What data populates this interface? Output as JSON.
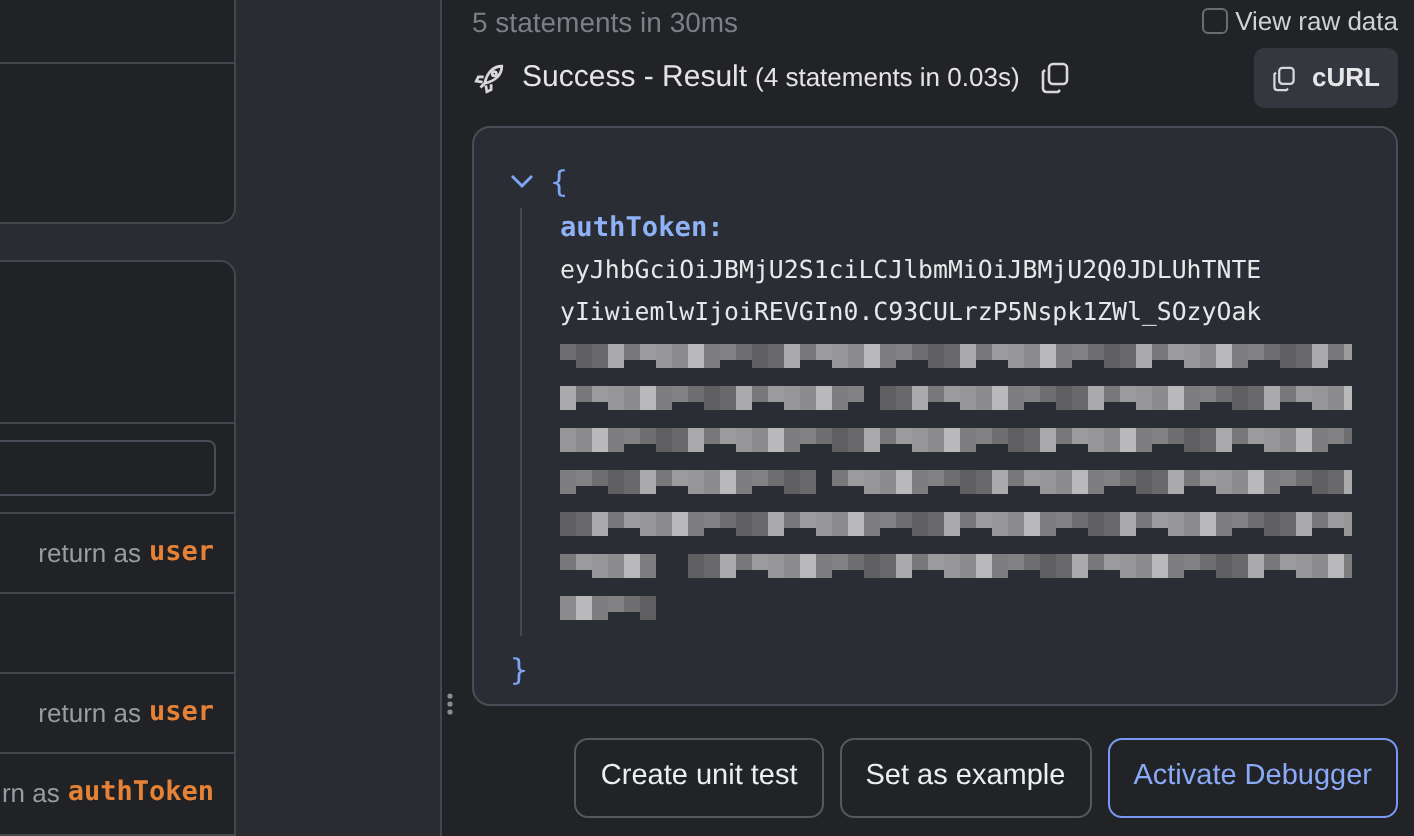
{
  "left_panel": {
    "rows": [
      {
        "kind": "return",
        "prefix": "return as",
        "variable": "user"
      },
      {
        "kind": "blank"
      },
      {
        "kind": "return",
        "prefix": "return as",
        "variable": "user"
      },
      {
        "kind": "return",
        "prefix": "rn as",
        "variable": "authToken"
      }
    ]
  },
  "run_summary": "5 statements in 30ms",
  "view_raw_data": {
    "label": "View raw data",
    "checked": false
  },
  "result": {
    "title": "Success - Result",
    "detail": "(4 statements in 0.03s)",
    "curl_button": "cURL",
    "json": {
      "expanded": true,
      "open_brace": "{",
      "close_brace": "}",
      "key": "authToken:",
      "value_lines": [
        "eyJhbGciOiJBMjU2S1ciLCJlbmMiOiJBMjU2Q0JDLUhTNTE",
        "yIiwiemlwIjoiREVGIn0.C93CULrzP5Nspk1ZWl_SOzyOak"
      ]
    }
  },
  "buttons": [
    {
      "label": "Create unit test",
      "primary": false
    },
    {
      "label": "Set as example",
      "primary": false
    },
    {
      "label": "Activate Debugger",
      "primary": true
    }
  ]
}
